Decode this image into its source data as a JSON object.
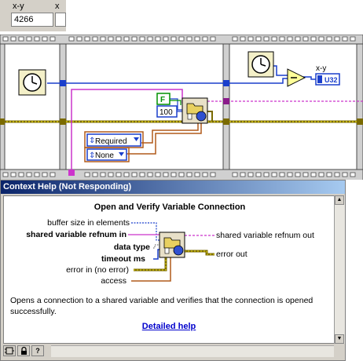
{
  "indicators": {
    "left_label": "x-y",
    "left_value": "4266",
    "right_label": "x"
  },
  "diagram": {
    "false_constant": "F",
    "numeric_constant": "100",
    "ring_required": "Required",
    "ring_none": "None",
    "output_label": "x-y",
    "output_type": "U32"
  },
  "context_help": {
    "window_title": "Context Help (Not Responding)",
    "heading": "Open and Verify Variable Connection",
    "terminals_left": [
      {
        "label": "buffer size in elements",
        "bold": false
      },
      {
        "label": "shared variable refnum in",
        "bold": true
      },
      {
        "label": "data type",
        "bold": true
      },
      {
        "label": "timeout ms",
        "bold": true
      },
      {
        "label": "error in (no error)",
        "bold": false
      },
      {
        "label": "access",
        "bold": false
      }
    ],
    "terminals_right": [
      {
        "label": "shared variable refnum out"
      },
      {
        "label": "error out"
      }
    ],
    "description": "Opens a connection to a shared variable and verifies that the connection is opened successfully.",
    "detailed_help_link": "Detailed help"
  },
  "colors": {
    "frame_border": "#4a4a4a",
    "sequence_fill": "#d0d0d0",
    "wire_numeric": "#1a3fcc",
    "wire_refnum": "#009090",
    "wire_error": "#7a6a00",
    "wire_pink": "#cc33cc",
    "wire_orange": "#b05a1a",
    "title_bar": "#0a246a"
  },
  "icons": [
    "clock-icon",
    "open-variable-icon",
    "subtract-icon",
    "scroll-arrow-icon",
    "lock-icon",
    "help-icon"
  ]
}
